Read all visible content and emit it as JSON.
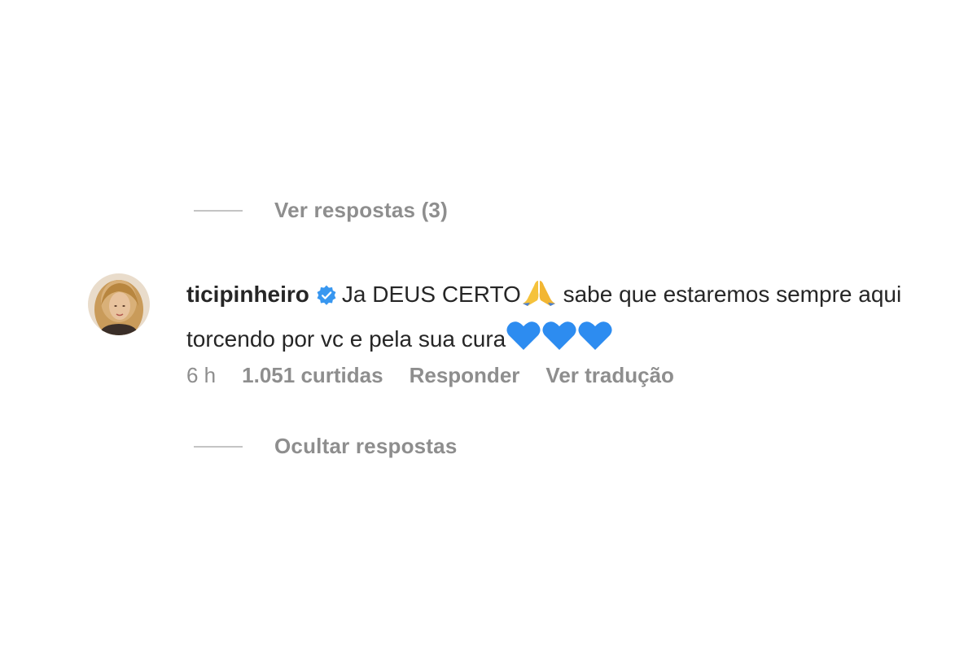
{
  "replies": {
    "view_label": "Ver respostas (3)",
    "hide_label": "Ocultar respostas"
  },
  "comment": {
    "username": "ticipinheiro",
    "verified": true,
    "text_part1": "Ja DEUS CERTO",
    "emoji_pray": "pray-emoji",
    "text_part2": " sabe que estaremos sempre aqui torcendo por vc e pela sua cura",
    "emoji_hearts": "blue-heart-emoji",
    "time": "6 h",
    "likes": "1.051 curtidas",
    "reply_label": "Responder",
    "translate_label": "Ver tradução"
  },
  "colors": {
    "text": "#262626",
    "secondary": "#8e8e8e",
    "verified_blue": "#3897f0",
    "heart_blue": "#2d8cf0"
  }
}
